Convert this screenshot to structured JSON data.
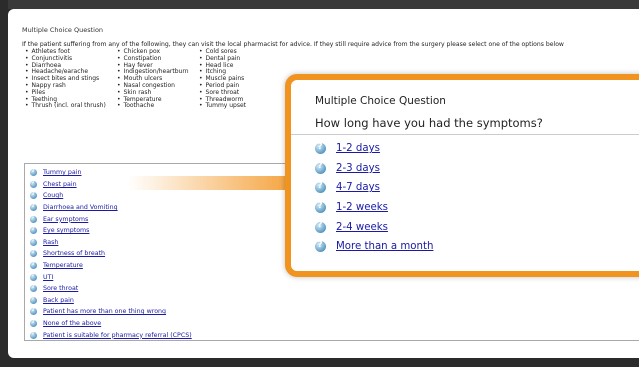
{
  "doc": {
    "title": "Multiple Choice Question",
    "intro": "If the patient suffering from any of the following, they can visit the local pharmacist for advice.  If they still require advice from the surgery please select one of the options below",
    "col1": [
      "Athletes foot",
      "Conjunctivitis",
      "Diarrhoea",
      "Headache/earache",
      "Insect bites and stings",
      "Nappy rash",
      "Piles",
      "Teething",
      "Thrush (incl. oral thrush)"
    ],
    "col2": [
      "Chicken pox",
      "Constipation",
      "Hay fever",
      "Indigestion/heartburn",
      "Mouth ulcers",
      "Nasal congestion",
      "Skin rash",
      "Temperature",
      "Toothache"
    ],
    "col3": [
      "Cold sores",
      "Dental pain",
      "Head lice",
      "Itching",
      "Muscle pains",
      "Period pain",
      "Sore throat",
      "Threadworm",
      "Tummy upset"
    ],
    "options": [
      "Tummy pain",
      "Chest pain",
      "Cough",
      "Diarrhoea and Vomiting",
      "Ear symptoms",
      "Eye symptoms",
      "Rash",
      "Shortness of breath",
      "Temperature",
      "UTI",
      "Sore throat",
      "Back pain",
      "Patient has more than one thing wrong",
      "None of the above",
      "Patient is suitable for pharmacy referral (CPCS)"
    ]
  },
  "popup": {
    "title": "Multiple Choice Question",
    "question": "How long have you had the symptoms?",
    "options": [
      "1-2 days",
      "2-3 days",
      "4-7 days",
      "1-2 weeks",
      "2-4 weeks",
      "More than a month"
    ]
  },
  "colors": {
    "accent": "#f0931f",
    "link": "#1a1aa6"
  }
}
